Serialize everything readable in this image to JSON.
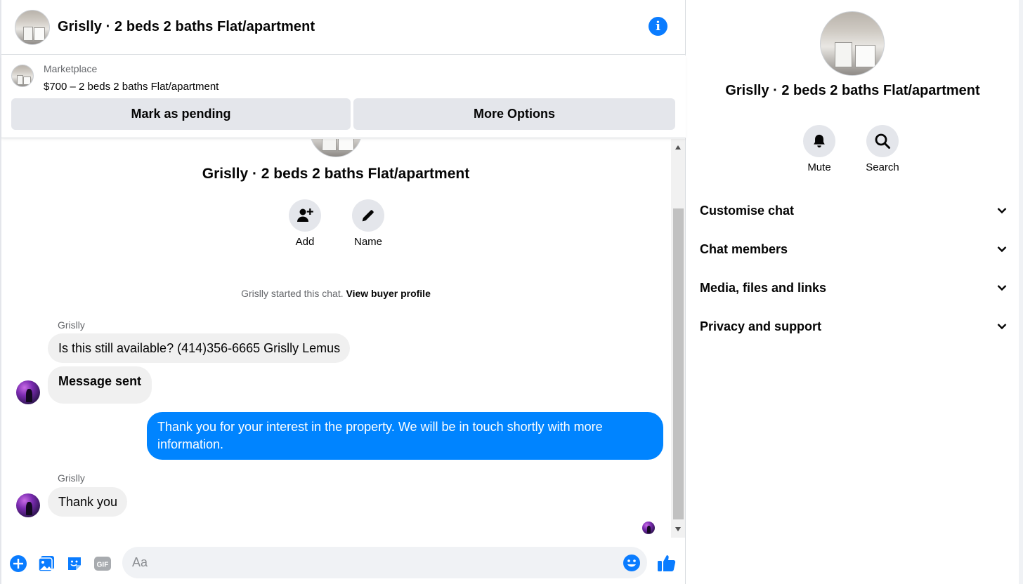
{
  "header": {
    "title": "Grislly · 2 beds 2 baths Flat/apartment",
    "info_icon": "info-icon",
    "info_glyph": "i"
  },
  "marketplace": {
    "label": "Marketplace",
    "price_line": "$700 – 2 beds 2 baths Flat/apartment",
    "pending_button": "Mark as pending",
    "more_button": "More Options"
  },
  "thread": {
    "title": "Grislly · 2 beds 2 baths Flat/apartment",
    "actions": [
      {
        "label": "Add",
        "icon": "add-person-icon"
      },
      {
        "label": "Name",
        "icon": "pencil-icon"
      }
    ],
    "system_message": "Grislly started this chat.",
    "system_link": "View buyer profile",
    "messages": [
      {
        "sender": "Grislly",
        "text": "Is this still available? (414)356-6665 Grislly Lemus",
        "direction": "incoming"
      },
      {
        "sender": "",
        "text": "Message sent",
        "direction": "incoming",
        "bold": true
      },
      {
        "sender": "",
        "text": "Thank you for your interest in the property. We will be in touch shortly with more information.",
        "direction": "outgoing"
      },
      {
        "sender": "Grislly",
        "text": "Thank you",
        "direction": "incoming"
      }
    ]
  },
  "composer": {
    "placeholder": "Aa",
    "icons": [
      "plus-icon",
      "photo-icon",
      "sticker-icon",
      "gif-icon",
      "emoji-icon",
      "thumbs-up-icon"
    ],
    "gif_glyph": "GIF"
  },
  "panel": {
    "title": "Grislly · 2 beds 2 baths Flat/apartment",
    "actions": [
      {
        "label": "Mute",
        "icon": "bell-icon"
      },
      {
        "label": "Search",
        "icon": "search-icon"
      }
    ],
    "sections": [
      {
        "label": "Customise chat"
      },
      {
        "label": "Chat members"
      },
      {
        "label": "Media, files and links"
      },
      {
        "label": "Privacy and support"
      }
    ]
  },
  "colors": {
    "accent": "#0084ff",
    "info_blue": "#0a7cff",
    "bubble_gray": "#f0f0f0",
    "button_gray": "#e4e6eb"
  }
}
